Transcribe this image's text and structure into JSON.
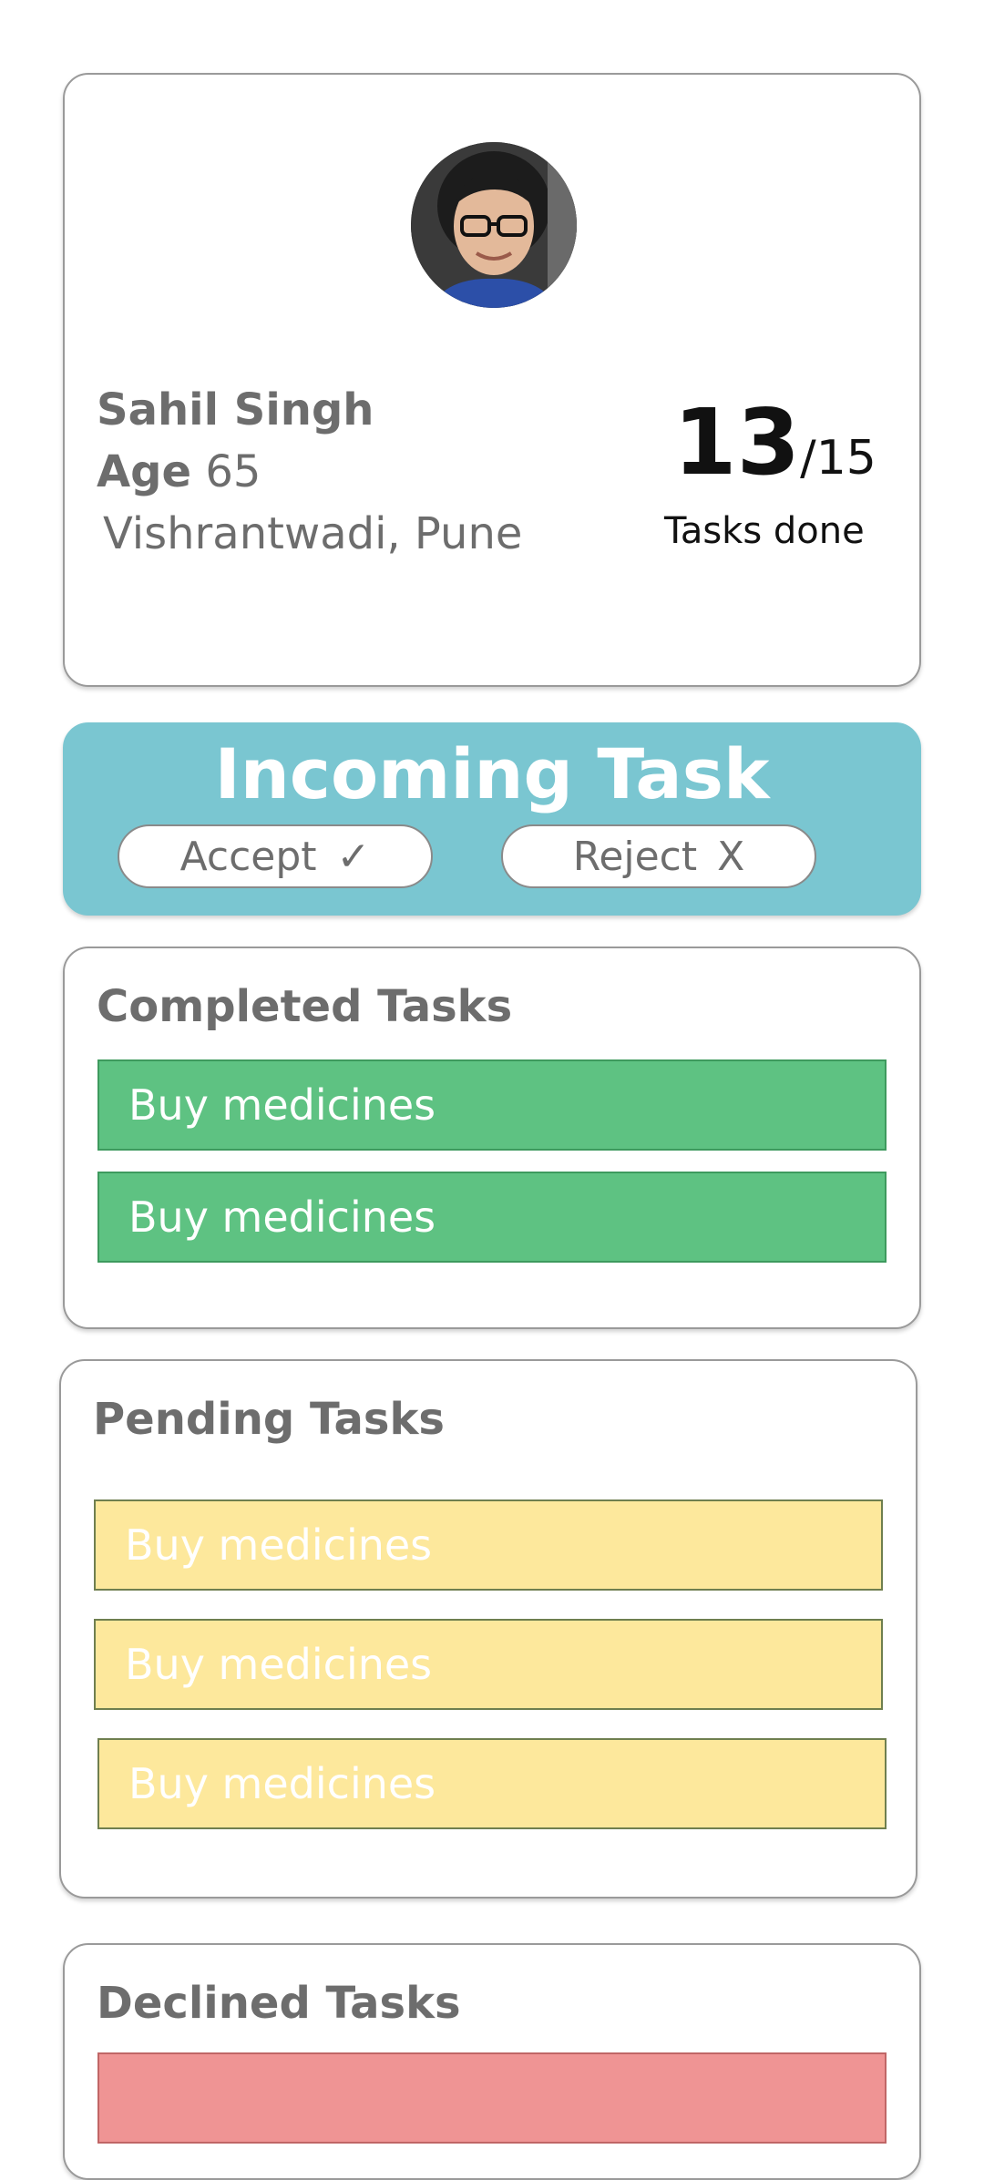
{
  "profile": {
    "name": "Sahil Singh",
    "age_label": "Age",
    "age_value": "65",
    "location": "Vishrantwadi, Pune",
    "tasks_done_count": "13",
    "tasks_total": "/15",
    "tasks_done_label": "Tasks done"
  },
  "incoming": {
    "title": "Incoming Task",
    "accept_label": "Accept",
    "accept_icon": "✓",
    "reject_label": "Reject",
    "reject_icon": "X"
  },
  "completed": {
    "title": "Completed Tasks",
    "tasks": [
      "Buy medicines",
      "Buy medicines"
    ]
  },
  "pending": {
    "title": "Pending Tasks",
    "tasks": [
      "Buy medicines",
      "Buy medicines",
      "Buy medicines"
    ]
  },
  "declined": {
    "title": "Declined Tasks"
  },
  "colors": {
    "incoming_bg": "#7ac6d1",
    "completed_row": "#5ec282",
    "pending_row": "#fde89c",
    "declined_row": "#ef9494",
    "label_text": "#6d6d6d"
  }
}
